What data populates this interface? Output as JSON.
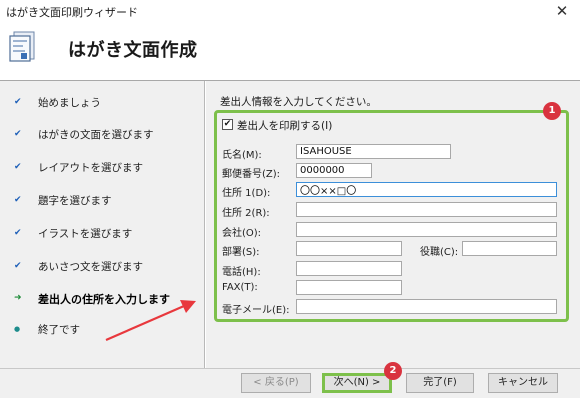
{
  "window": {
    "title": "はがき文面印刷ウィザード",
    "close_glyph": "✕"
  },
  "header": {
    "title": "はがき文面作成",
    "icon": "postcard-document-icon"
  },
  "steps": [
    {
      "label": "始めましょう",
      "status": "done"
    },
    {
      "label": "はがきの文面を選びます",
      "status": "done"
    },
    {
      "label": "レイアウトを選びます",
      "status": "done"
    },
    {
      "label": "題字を選びます",
      "status": "done"
    },
    {
      "label": "イラストを選びます",
      "status": "done"
    },
    {
      "label": "あいさつ文を選びます",
      "status": "done"
    },
    {
      "label": "差出人の住所を入力します",
      "status": "current"
    },
    {
      "label": "終了です",
      "status": "future"
    }
  ],
  "step_marks": {
    "done": "✔",
    "current": "➜",
    "future": "●"
  },
  "form": {
    "instruction": "差出人情報を入力してください。",
    "print_sender": {
      "label": "差出人を印刷する(I)",
      "checked": true,
      "check_glyph": "✔"
    },
    "fields": {
      "name": {
        "label": "氏名(M):",
        "value": "ISAHOUSE"
      },
      "postal": {
        "label": "郵便番号(Z):",
        "value": "0000000"
      },
      "address1": {
        "label": "住所 1(D):",
        "value": "〇〇××□〇"
      },
      "address2": {
        "label": "住所 2(R):",
        "value": ""
      },
      "company": {
        "label": "会社(O):",
        "value": ""
      },
      "department": {
        "label": "部署(S):",
        "value": ""
      },
      "position": {
        "label": "役職(C):",
        "value": ""
      },
      "phone": {
        "label": "電話(H):",
        "value": ""
      },
      "fax": {
        "label": "FAX(T):",
        "value": ""
      },
      "email": {
        "label": "電子メール(E):",
        "value": ""
      }
    }
  },
  "annotations": {
    "badge1": "1",
    "badge2": "2",
    "highlight_color": "#7dc04b",
    "arrow_color": "#e8383d",
    "badge_color": "#d9333f"
  },
  "footer": {
    "back": "< 戻る(P)",
    "next": "次へ(N) >",
    "finish": "完了(F)",
    "cancel": "キャンセル"
  }
}
